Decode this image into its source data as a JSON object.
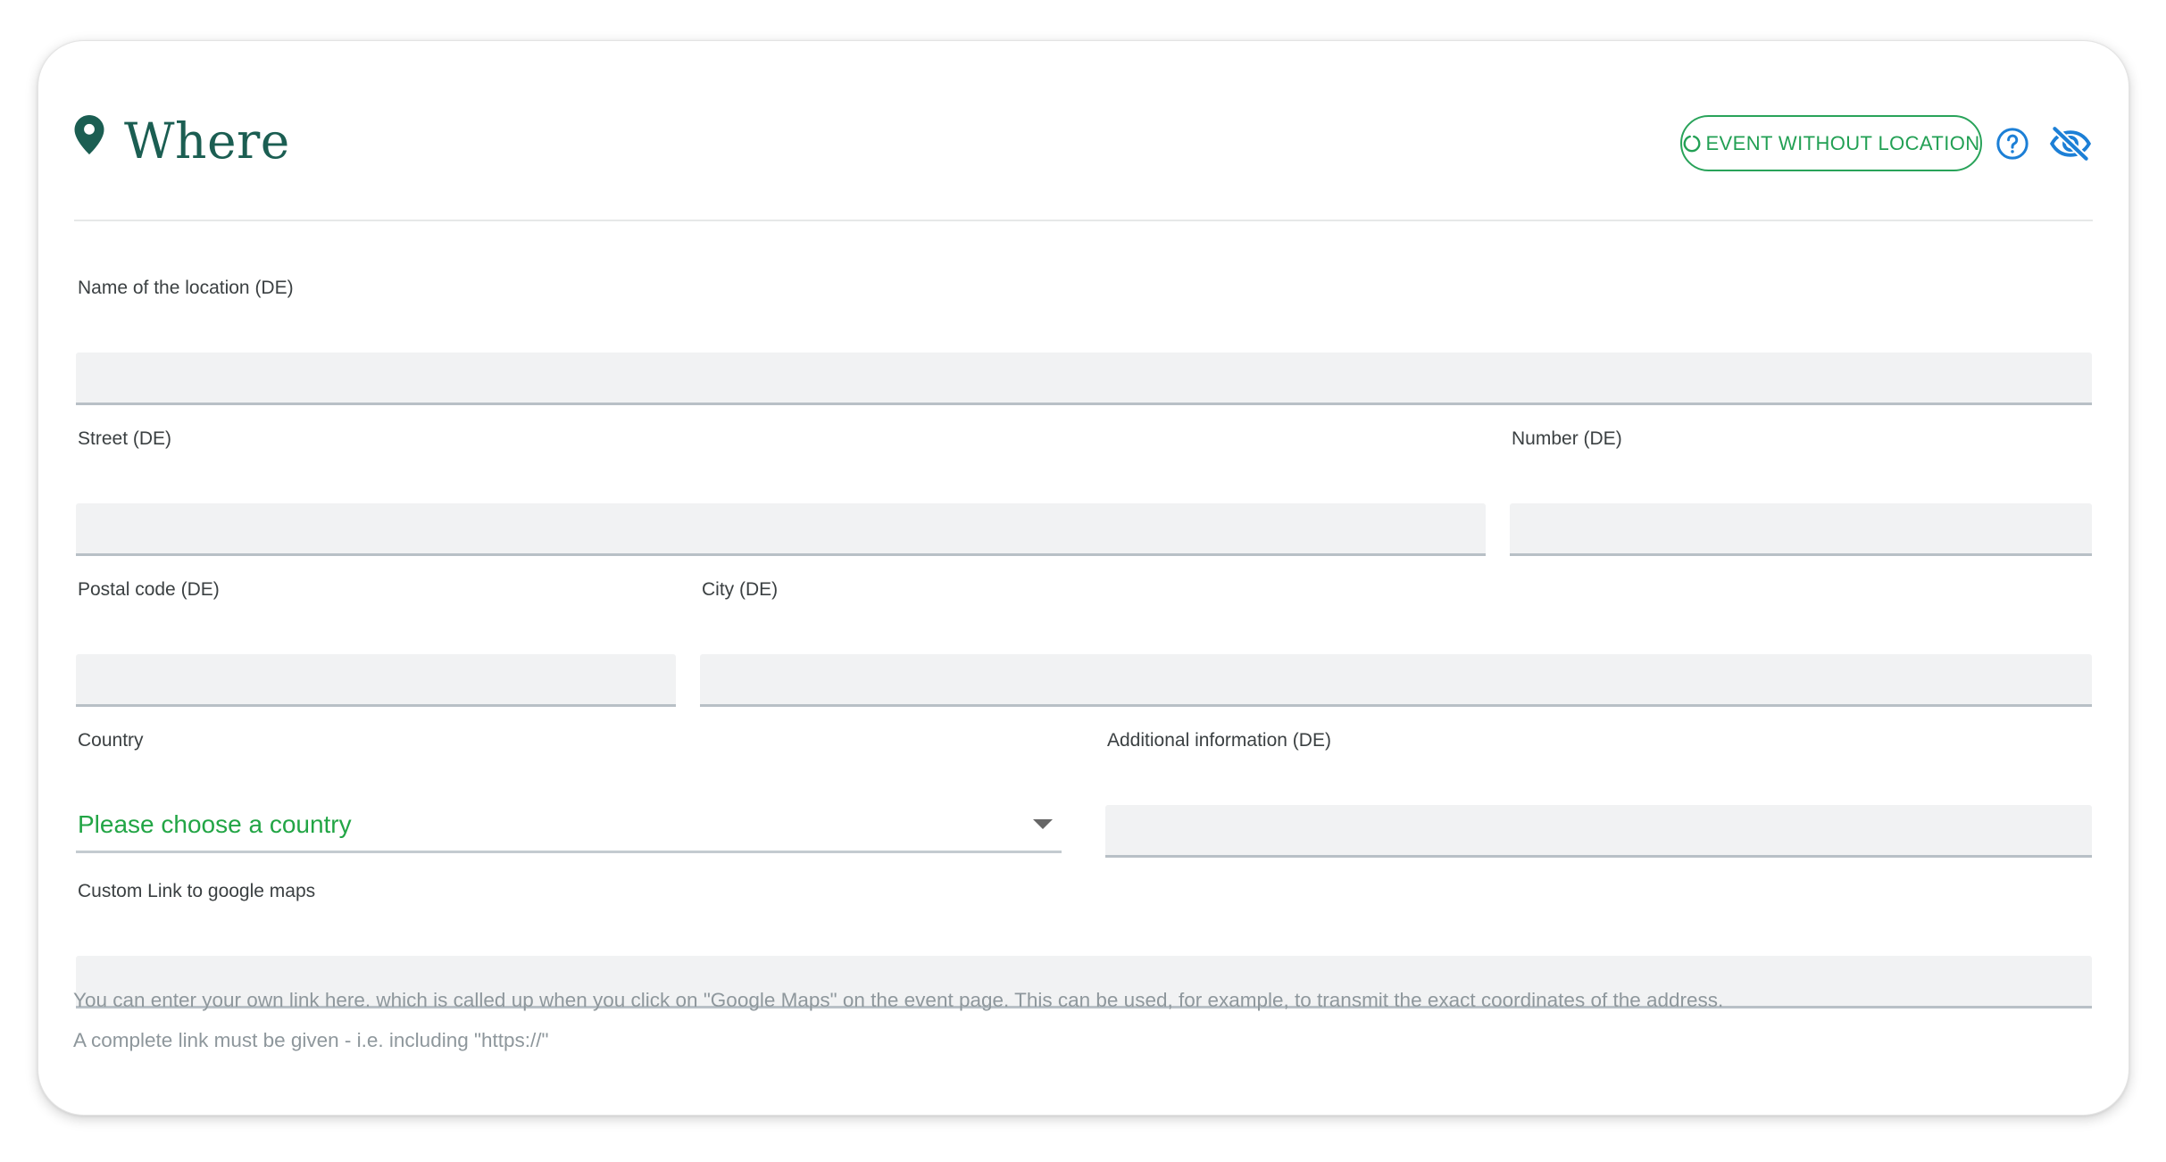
{
  "section": {
    "title": "Where",
    "icon": "map-pin-icon",
    "accent_color": "#1b5e52"
  },
  "actions": {
    "event_without_location_label": "EVENT WITHOUT LOCATION",
    "event_without_location_color": "#22a054",
    "help_icon": "question-circle-icon",
    "visibility_icon": "eye-slash-icon"
  },
  "fields": {
    "location_name": {
      "label": "Name of the location (DE)",
      "value": ""
    },
    "street": {
      "label": "Street (DE)",
      "value": ""
    },
    "number": {
      "label": "Number (DE)",
      "value": ""
    },
    "postal_code": {
      "label": "Postal code (DE)",
      "value": ""
    },
    "city": {
      "label": "City (DE)",
      "value": ""
    },
    "country": {
      "label": "Country",
      "selected": "Please choose a country"
    },
    "additional_info": {
      "label": "Additional information (DE)",
      "value": ""
    },
    "custom_link": {
      "label": "Custom Link to google maps",
      "value": ""
    }
  },
  "hints": {
    "line1": "You can enter your own link here. which is called up when you click on \"Google Maps\" on the event page. This can be used, for example, to transmit the exact coordinates of the address.",
    "line2": "A complete link must be given - i.e. including \"https://\""
  }
}
